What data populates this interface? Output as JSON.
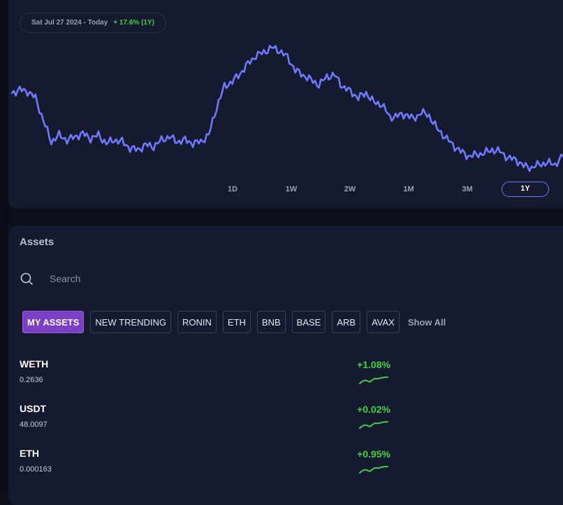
{
  "chart": {
    "date_range": "Sat Jul 27 2024 - Today",
    "change": "+ 17.6% (1Y)",
    "line_color": "#6f79ff",
    "timeframes": [
      "1D",
      "1W",
      "2W",
      "1M",
      "3M",
      "1Y"
    ],
    "active_timeframe": "1Y"
  },
  "chart_data": {
    "type": "line",
    "title": "",
    "xlabel": "",
    "ylabel": "",
    "grid": false,
    "series": [
      {
        "values": [
          4.8,
          5.0,
          4.9,
          4.5,
          3.1,
          1.8,
          2.2,
          1.9,
          2.1,
          2.3,
          2.0,
          2.2,
          1.7,
          1.9,
          1.8,
          1.4,
          1.3,
          1.6,
          1.5,
          1.9,
          2.1,
          1.8,
          1.9,
          1.7,
          1.8,
          2.2,
          3.9,
          5.2,
          5.5,
          6.0,
          6.6,
          7.1,
          7.3,
          7.6,
          7.4,
          7.0,
          6.2,
          5.9,
          5.6,
          5.3,
          5.8,
          5.9,
          5.2,
          4.9,
          4.5,
          4.8,
          4.2,
          4.1,
          3.3,
          3.4,
          3.5,
          3.2,
          3.6,
          3.4,
          2.6,
          2.1,
          1.6,
          1.2,
          0.9,
          1.0,
          1.1,
          1.3,
          1.2,
          0.8,
          0.7,
          0.3,
          0.2,
          0.4,
          0.5,
          0.4,
          0.9
        ]
      }
    ]
  },
  "assets": {
    "title": "Assets",
    "search_placeholder": "Search",
    "filters": [
      "MY ASSETS",
      "NEW TRENDING",
      "RONIN",
      "ETH",
      "BNB",
      "BASE",
      "ARB",
      "AVAX"
    ],
    "active_filter": "MY ASSETS",
    "show_all": "Show All",
    "rows": [
      {
        "name": "WETH",
        "amount": "0.2636",
        "change": "+1.08%"
      },
      {
        "name": "USDT",
        "amount": "48.0097",
        "change": "+0.02%"
      },
      {
        "name": "ETH",
        "amount": "0.000163",
        "change": "+0.95%"
      }
    ],
    "positive_color": "#3fd14b"
  }
}
